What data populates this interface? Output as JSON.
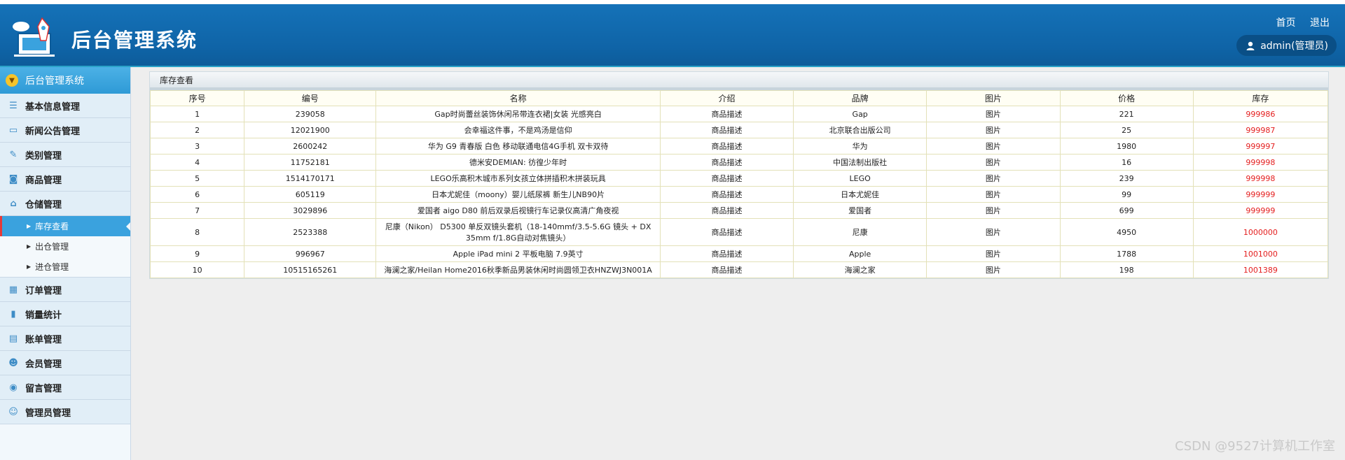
{
  "header": {
    "title": "后台管理系统",
    "links": [
      "首页",
      "退出"
    ],
    "user": "admin(管理员)"
  },
  "sidebar": {
    "title": "后台管理系统",
    "items": [
      {
        "label": "基本信息管理",
        "icon": "list-icon"
      },
      {
        "label": "新闻公告管理",
        "icon": "message-icon"
      },
      {
        "label": "类别管理",
        "icon": "edit-icon"
      },
      {
        "label": "商品管理",
        "icon": "bag-icon"
      },
      {
        "label": "仓储管理",
        "icon": "home-icon"
      }
    ],
    "subitems": [
      {
        "label": "库存查看",
        "active": true
      },
      {
        "label": "出仓管理",
        "active": false
      },
      {
        "label": "进仓管理",
        "active": false
      }
    ],
    "items2": [
      {
        "label": "订单管理",
        "icon": "calendar-icon"
      },
      {
        "label": "销量统计",
        "icon": "chart-icon"
      },
      {
        "label": "账单管理",
        "icon": "document-icon"
      },
      {
        "label": "会员管理",
        "icon": "users-icon"
      },
      {
        "label": "留言管理",
        "icon": "chat-icon"
      },
      {
        "label": "管理员管理",
        "icon": "user-icon"
      }
    ]
  },
  "panel": {
    "title": "库存查看",
    "columns": [
      "序号",
      "编号",
      "名称",
      "介绍",
      "品牌",
      "图片",
      "价格",
      "库存"
    ],
    "rows": [
      [
        "1",
        "239058",
        "Gap时尚蕾丝装饰休闲吊带连衣裙|女装 光感亮白",
        "商品描述",
        "Gap",
        "图片",
        "221",
        "999986"
      ],
      [
        "2",
        "12021900",
        "会幸福这件事，不是鸡汤是信仰",
        "商品描述",
        "北京联合出版公司",
        "图片",
        "25",
        "999987"
      ],
      [
        "3",
        "2600242",
        "华为 G9 青春版 白色 移动联通电信4G手机 双卡双待",
        "商品描述",
        "华为",
        "图片",
        "1980",
        "999997"
      ],
      [
        "4",
        "11752181",
        "德米安DEMIAN: 彷徨少年时",
        "商品描述",
        "中国法制出版社",
        "图片",
        "16",
        "999998"
      ],
      [
        "5",
        "1514170171",
        "LEGO乐高积木城市系列女孩立体拼插积木拼装玩具",
        "商品描述",
        "LEGO",
        "图片",
        "239",
        "999998"
      ],
      [
        "6",
        "605119",
        "日本尤妮佳（moony）婴儿纸尿裤 新生儿NB90片",
        "商品描述",
        "日本尤妮佳",
        "图片",
        "99",
        "999999"
      ],
      [
        "7",
        "3029896",
        "爱国者 aigo D80 前后双录后视镜行车记录仪高清广角夜视",
        "商品描述",
        "爱国者",
        "图片",
        "699",
        "999999"
      ],
      [
        "8",
        "2523388",
        "尼康（Nikon） D5300 单反双镜头套机（18-140mmf/3.5-5.6G 镜头 + DX 35mm f/1.8G自动对焦镜头）",
        "商品描述",
        "尼康",
        "图片",
        "4950",
        "1000000"
      ],
      [
        "9",
        "996967",
        "Apple iPad mini 2 平板电脑 7.9英寸",
        "商品描述",
        "Apple",
        "图片",
        "1788",
        "1001000"
      ],
      [
        "10",
        "10515165261",
        "海澜之家/Heilan Home2016秋季新品男装休闲时尚圆领卫衣HNZWJ3N001A",
        "商品描述",
        "海澜之家",
        "图片",
        "198",
        "1001389"
      ]
    ]
  },
  "watermark": "CSDN @9527计算机工作室"
}
